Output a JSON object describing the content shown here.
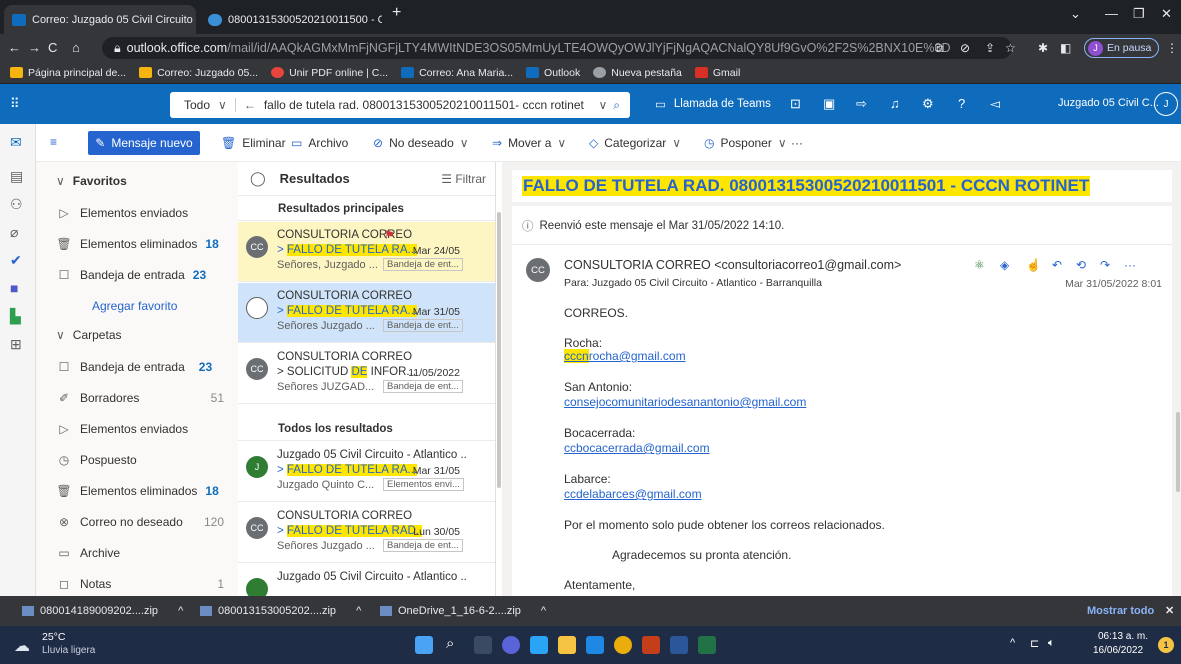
{
  "browser": {
    "tabs": [
      {
        "title": "Correo: Juzgado 05 Civil Circuito",
        "active": true
      },
      {
        "title": "0800131530052021001150​0 - On",
        "active": false
      }
    ],
    "new_tab": "+",
    "url_host": "outlook.office.com",
    "url_path": "/mail/id/AAQkAGMxMmFjNGFjLTY4MWItNDE3OS05MmUyLTE4OWQyOWJlYjFjNgAQACNalQY8Uf9GvO%2F2S%2BNX10E%3D",
    "profile_initial": "J",
    "profile_status": "En pausa",
    "bookmarks": [
      {
        "label": "Página principal de...",
        "color": "#f6b40e"
      },
      {
        "label": "Correo: Juzgado 05...",
        "color": "#f6b40e"
      },
      {
        "label": "Unir PDF online | C...",
        "color": "#e8453c"
      },
      {
        "label": "Correo: Ana Maria...",
        "color": "#0f6cbd"
      },
      {
        "label": "Outlook",
        "color": "#0f6cbd"
      },
      {
        "label": "Nueva pestaña",
        "color": "#9aa0a6"
      },
      {
        "label": "Gmail",
        "color": "#d93025"
      }
    ]
  },
  "outlook": {
    "search_scope": "Todo",
    "search_query": "fallo de tutela rad. 08001315300520210011501- cccn rotinet",
    "teams_label": "Llamada de Teams",
    "account_name": "Juzgado 05 Civil C...",
    "account_initial": "J"
  },
  "commands": {
    "new_message": "Mensaje nuevo",
    "delete": "Eliminar",
    "archive": "Archivo",
    "junk": "No deseado",
    "move": "Mover a",
    "categorize": "Categorizar",
    "snooze": "Posponer",
    "more": "···"
  },
  "folders": {
    "favorites_header": "Favoritos",
    "favorites": [
      {
        "label": "Elementos enviados",
        "count": "",
        "icon": "send-icon"
      },
      {
        "label": "Elementos eliminados",
        "count": "18",
        "icon": "trash-icon"
      },
      {
        "label": "Bandeja de entrada",
        "count": "23",
        "icon": "inbox-icon"
      }
    ],
    "add_favorite": "Agregar favorito",
    "folders_header": "Carpetas",
    "folders": [
      {
        "label": "Bandeja de entrada",
        "count": "23",
        "icon": "inbox-icon",
        "bold": true
      },
      {
        "label": "Borradores",
        "count": "51",
        "icon": "draft-icon",
        "bold": false
      },
      {
        "label": "Elementos enviados",
        "count": "",
        "icon": "send-icon",
        "bold": false
      },
      {
        "label": "Pospuesto",
        "count": "",
        "icon": "clock-icon",
        "bold": false
      },
      {
        "label": "Elementos eliminados",
        "count": "18",
        "icon": "trash-icon",
        "bold": true
      },
      {
        "label": "Correo no deseado",
        "count": "120",
        "icon": "junk-icon",
        "bold": false
      },
      {
        "label": "Archive",
        "count": "",
        "icon": "archive-icon",
        "bold": false
      },
      {
        "label": "Notas",
        "count": "1",
        "icon": "note-icon",
        "bold": false
      }
    ]
  },
  "message_list": {
    "header": "Resultados",
    "filter": "Filtrar",
    "top_section": "Resultados principales",
    "all_section": "Todos los resultados",
    "top_results": [
      {
        "avatar": "CC",
        "avatar_color": "#6b6e73",
        "from": "CONSULTORIA CORREO",
        "subject_pre": "> ",
        "subject_hl": "FALLO DE TUTELA RA...",
        "date": "Mar 24/05",
        "preview": "Señores, Juzgado ...",
        "tag": "Bandeja de ent...",
        "flagged": true
      },
      {
        "avatar": "",
        "avatar_color": "",
        "from": "CONSULTORIA CORREO",
        "subject_pre": "> ",
        "subject_hl": "FALLO DE TUTELA RA...",
        "date": "Mar 31/05",
        "preview": "Señores Juzgado ...",
        "tag": "Bandeja de ent...",
        "flagged": false,
        "selected": true
      },
      {
        "avatar": "CC",
        "avatar_color": "#6b6e73",
        "from": "CONSULTORIA CORREO",
        "subject_pre": "> SOLICITUD ",
        "subject_hl": "DE",
        "subject_post": " INFOR...",
        "date": "11/05/2022",
        "preview": "Señores JUZGAD...",
        "tag": "Bandeja de ent...",
        "flagged": false
      }
    ],
    "all_results": [
      {
        "avatar": "J",
        "avatar_color": "#2e7d32",
        "from": "Juzgado 05 Civil Circuito - Atlantico ...",
        "subject_pre": "> ",
        "subject_hl": "FALLO DE TUTELA RA...",
        "date": "Mar 31/05",
        "preview": "Juzgado Quinto C...",
        "tag": "Elementos envi..."
      },
      {
        "avatar": "CC",
        "avatar_color": "#6b6e73",
        "from": "CONSULTORIA CORREO",
        "subject_pre": "> ",
        "subject_hl": "FALLO DE TUTELA RAD..",
        "date": "Lun 30/05",
        "preview": "Señores Juzgado ...",
        "tag": "Bandeja de ent..."
      },
      {
        "avatar": "",
        "avatar_color": "#2e7d32",
        "from": "Juzgado 05 Civil Circuito - Atlantico ...",
        "subject_pre": "",
        "subject_hl": "",
        "date": "",
        "preview": "",
        "tag": ""
      }
    ]
  },
  "reading": {
    "subject": "FALLO DE TUTELA RAD. 08001315300520210011501 - CCCN ROTINET",
    "forward_note": "Reenvió este mensaje el Mar 31/05/2022 14:10.",
    "sender_initials": "CC",
    "sender": "CONSULTORIA CORREO <consultoriacorreo1@gmail.com>",
    "to": "Para:  Juzgado 05 Civil Circuito - Atlantico - Barranquilla",
    "sent": "Mar 31/05/2022 8:01",
    "greeting": "CORREOS.",
    "entries": [
      {
        "place": "Rocha:",
        "email_hl": "cccn",
        "email": "rocha@gmail.com"
      },
      {
        "place": "San Antonio:",
        "email_hl": "",
        "email": "consejocomunitariodesanantonio@gmail.com"
      },
      {
        "place": "Bocacerrada:",
        "email_hl": "",
        "email": "ccbocacerrada@gmail.com"
      },
      {
        "place": "Labarce:",
        "email_hl": "",
        "email": "ccdelabarces@gmail.com"
      }
    ],
    "note": "Por el momento solo pude obtener los correos relacionados.",
    "thanks": "Agradecemos su pronta atención.",
    "closing": "Atentamente,"
  },
  "downloads": {
    "items": [
      "080014189009202....zip",
      "080013153005202....zip",
      "OneDrive_1_16-6-2....zip"
    ],
    "show_all": "Mostrar todo"
  },
  "taskbar": {
    "temp": "25°C",
    "weather": "Lluvia ligera",
    "time": "06:13 a. m.",
    "date": "16/06/2022",
    "notif": "1"
  }
}
